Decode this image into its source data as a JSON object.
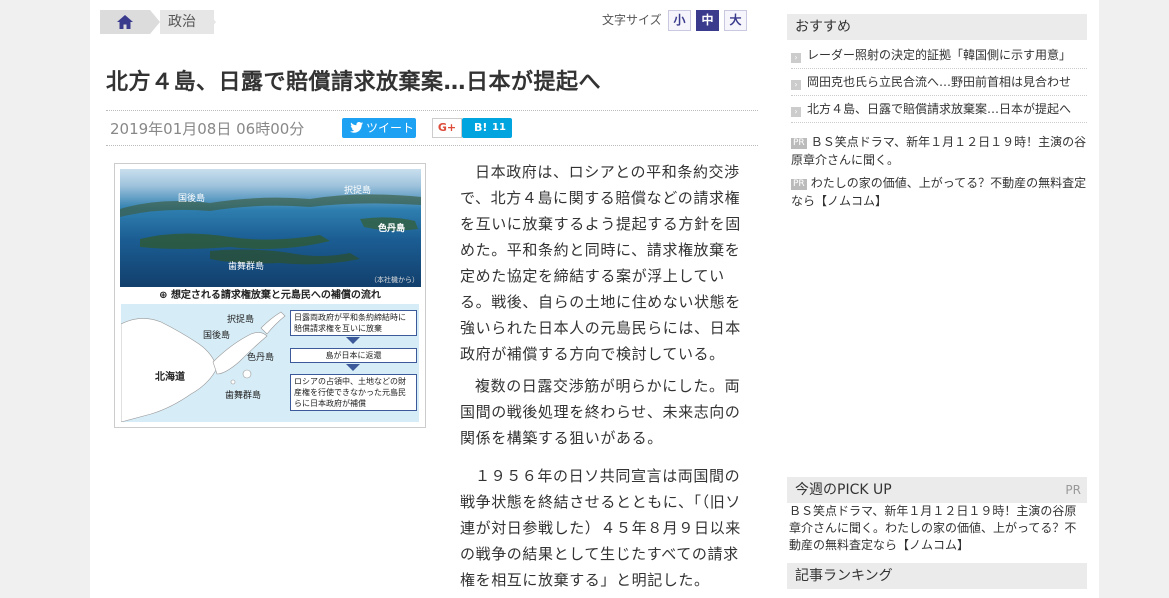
{
  "breadcrumb": {
    "home_icon": "home-icon",
    "category": "政治"
  },
  "font_size": {
    "label": "文字サイズ",
    "small": "小",
    "medium": "中",
    "large": "大"
  },
  "article": {
    "title": "北方４島、日露で賠償請求放棄案…日本が提起へ",
    "date": "2019年01月08日 06時00分",
    "share": {
      "tweet": "ツイート",
      "gplus": "G+",
      "hatena_label": "B!",
      "hatena_count": "11"
    },
    "figure": {
      "photo_labels": {
        "kunashiri": "国後島",
        "etorofu": "択捉島",
        "shikotan": "色丹島",
        "habomai": "歯舞群島",
        "credit": "（本社機から）"
      },
      "caption": "想定される請求権放棄と元島民への補償の流れ",
      "map_labels": {
        "hokkaido": "北海道",
        "kunashiri": "国後島",
        "etorofu": "択捉島",
        "shikotan": "色丹島",
        "habomai": "歯舞群島"
      },
      "flow": [
        "日露両政府が平和条約締結時に賠償請求権を互いに放棄",
        "島が日本に返還",
        "ロシアの占領中、土地などの財産権を行使できなかった元島民らに日本政府が補償"
      ]
    },
    "paragraphs": [
      "日本政府は、ロシアとの平和条約交渉で、北方４島に関する賠償などの請求権を互いに放棄するよう提起する方針を固めた。平和条約と同時に、請求権放棄を定めた協定を締結する案が浮上している。戦後、自らの土地に住めない状態を強いられた日本人の元島民らには、日本政府が補償する方向で検討している。",
      "複数の日露交渉筋が明らかにした。両国間の戦後処理を終わらせ、未来志向の関係を構築する狙いがある。",
      "１９５６年の日ソ共同宣言は両国間の戦争状態を終結させるとともに、「（旧ソ連が対日参戦した）４５年８月９日以来の戦争の結果として生じたすべての請求権を相互に放棄する」と明記した。"
    ]
  },
  "sidebar": {
    "recommend_title": "おすすめ",
    "recommend_items": [
      "レーダー照射の決定的証拠「韓国側に示す用意」",
      "岡田克也氏ら立民合流へ…野田前首相は見合わせ",
      "北方４島、日露で賠償請求放棄案…日本が提起へ"
    ],
    "pr_tag": "PR",
    "pr_items": [
      "ＢＳ笑点ドラマ、新年１月１２日１９時！主演の谷原章介さんに聞く。",
      "わたしの家の価値、上がってる？不動産の無料査定なら【ノムコム】"
    ],
    "pickup_title": "今週のPICK UP",
    "pickup_pr": "PR",
    "pickup_text": "ＢＳ笑点ドラマ、新年１月１２日１９時！主演の谷原章介さんに聞く。わたしの家の価値、上がってる？不動産の無料査定なら【ノムコム】",
    "ranking_title": "記事ランキング"
  },
  "colors": {
    "accent": "#3b3b8e",
    "twitter": "#1da1f2",
    "hatena": "#00a4de"
  }
}
